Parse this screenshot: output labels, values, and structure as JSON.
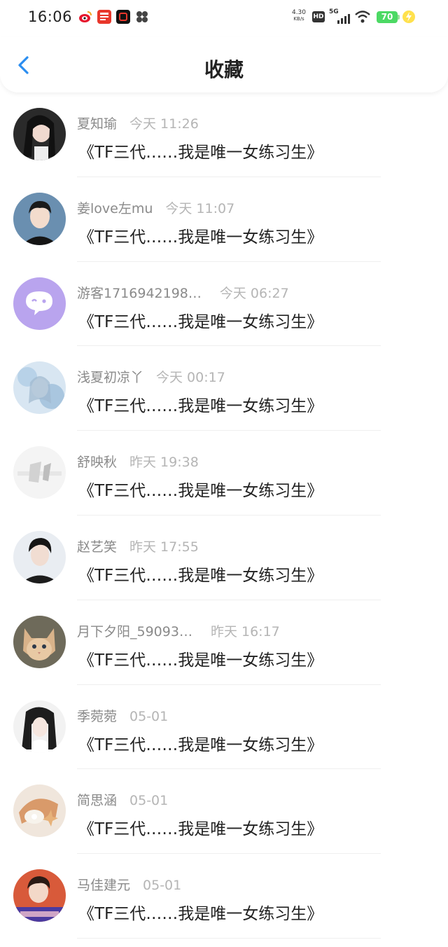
{
  "status_bar": {
    "time": "16:06",
    "net_speed_value": "4.30",
    "net_speed_unit": "KB/s",
    "hd": "HD",
    "network": "5G",
    "battery": "70",
    "app_icons": [
      "weibo-icon",
      "toutiao-icon",
      "app-icon-dark",
      "clover-app-icon"
    ]
  },
  "header": {
    "title": "收藏",
    "back_icon": "chevron-left-icon"
  },
  "colors": {
    "accent": "#2b8ef0",
    "name_text": "#8a8a8a",
    "time_text": "#b5b5b5",
    "title_text": "#222222",
    "battery": "#4cd964"
  },
  "favorites": [
    {
      "name": "夏知瑜",
      "time": "今天 11:26",
      "title": "《TF三代……我是唯一女练习生》"
    },
    {
      "name": "姜love左mu",
      "time": "今天 11:07",
      "title": "《TF三代……我是唯一女练习生》"
    },
    {
      "name": "游客1716942198…",
      "time": "今天 06:27",
      "title": "《TF三代……我是唯一女练习生》"
    },
    {
      "name": "浅夏初凉丫",
      "time": "今天 00:17",
      "title": "《TF三代……我是唯一女练习生》"
    },
    {
      "name": "舒映秋",
      "time": "昨天 19:38",
      "title": "《TF三代……我是唯一女练习生》"
    },
    {
      "name": "赵艺笑",
      "time": "昨天 17:55",
      "title": "《TF三代……我是唯一女练习生》"
    },
    {
      "name": "月下夕阳_59093…",
      "time": "昨天 16:17",
      "title": "《TF三代……我是唯一女练习生》"
    },
    {
      "name": "季菀菀",
      "time": "05-01",
      "title": "《TF三代……我是唯一女练习生》"
    },
    {
      "name": "简思涵",
      "time": "05-01",
      "title": "《TF三代……我是唯一女练习生》"
    },
    {
      "name": "马佳建元",
      "time": "05-01",
      "title": "《TF三代……我是唯一女练习生》"
    }
  ]
}
